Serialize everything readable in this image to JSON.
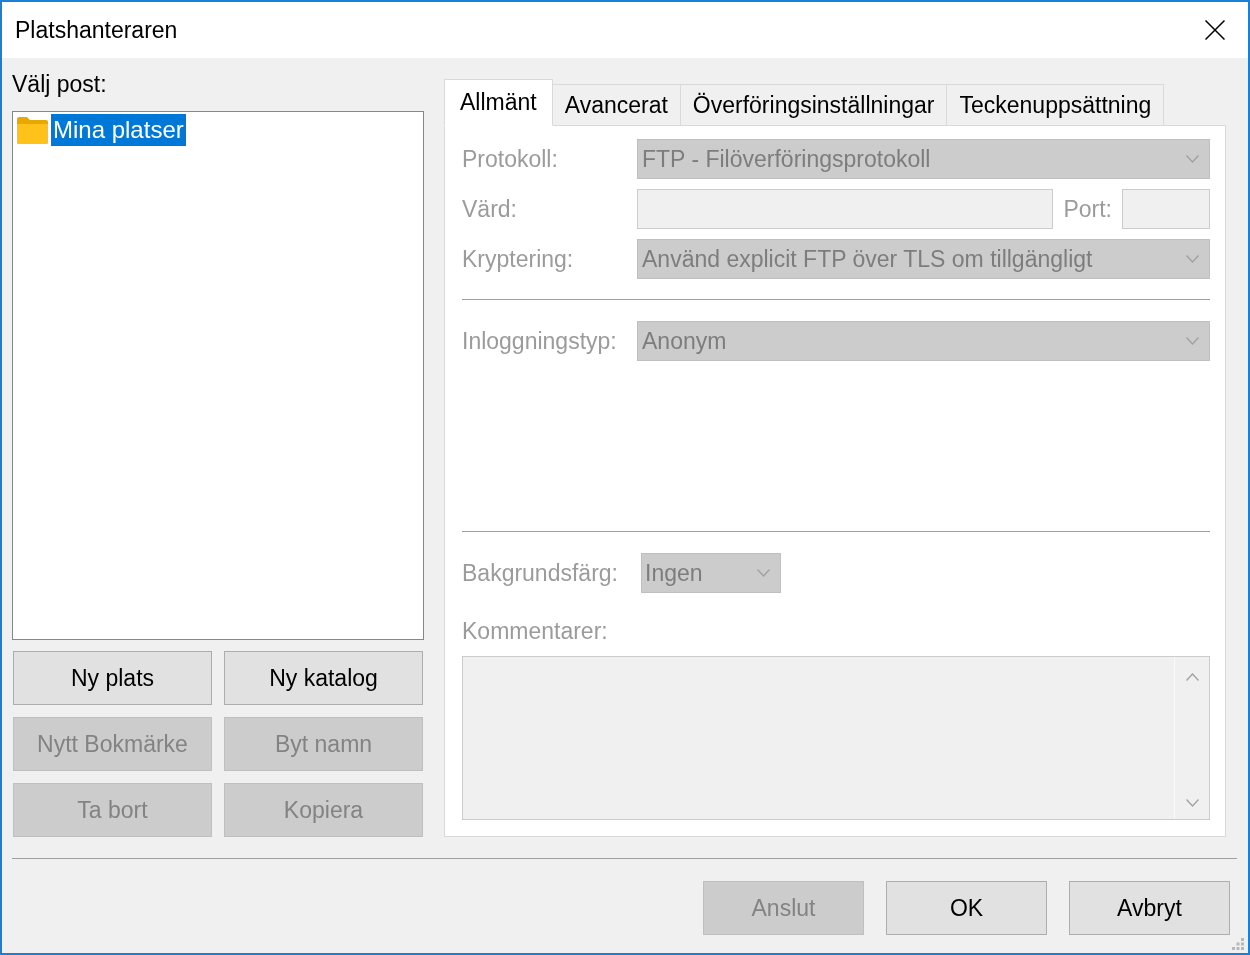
{
  "window": {
    "title": "Platshanteraren"
  },
  "entries": {
    "label": "Välj post:",
    "tree": [
      {
        "label": "Mina platser",
        "kind": "folder",
        "selected": true
      }
    ]
  },
  "entry_buttons": [
    {
      "label": "Ny plats",
      "disabled": false
    },
    {
      "label": "Ny katalog",
      "disabled": false
    },
    {
      "label": "Nytt Bokmärke",
      "disabled": true
    },
    {
      "label": "Byt namn",
      "disabled": true
    },
    {
      "label": "Ta bort",
      "disabled": true
    },
    {
      "label": "Kopiera",
      "disabled": true
    }
  ],
  "tabs": [
    {
      "label": "Allmänt",
      "selected": true
    },
    {
      "label": "Avancerat",
      "selected": false
    },
    {
      "label": "Överföringsinställningar",
      "selected": false
    },
    {
      "label": "Teckenuppsättning",
      "selected": false
    }
  ],
  "general": {
    "protocol": {
      "label": "Protokoll:",
      "value": "FTP - Filöverföringsprotokoll",
      "disabled": true
    },
    "host": {
      "label": "Värd:",
      "disabled": true
    },
    "port": {
      "label": "Port:",
      "disabled": true
    },
    "encryption": {
      "label": "Kryptering:",
      "value": "Använd explicit FTP över TLS om tillgängligt",
      "disabled": true
    },
    "logon_type": {
      "label": "Inloggningstyp:",
      "value": "Anonym",
      "disabled": true
    },
    "background_color": {
      "label": "Bakgrundsfärg:",
      "value": "Ingen",
      "disabled": true
    },
    "comments": {
      "label": "Kommentarer:",
      "disabled": true
    }
  },
  "buttons": [
    {
      "label": "Anslut",
      "disabled": true
    },
    {
      "label": "OK",
      "disabled": false
    },
    {
      "label": "Avbryt",
      "disabled": false
    }
  ]
}
